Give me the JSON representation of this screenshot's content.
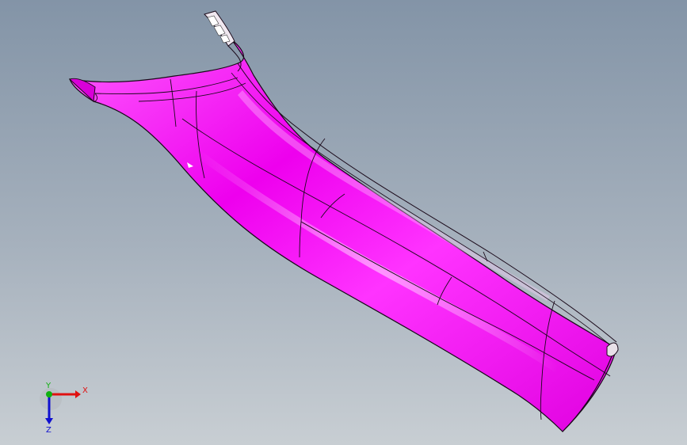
{
  "viewport": {
    "background_top": "#8394a7",
    "background_bottom": "#c8ced3"
  },
  "model": {
    "surface_color": "#ff00ff",
    "edge_color": "#1a0a1a"
  },
  "triad": {
    "x_label": "X",
    "y_label": "Y",
    "z_label": "Z",
    "x_color": "#e01010",
    "y_color": "#10b010",
    "z_color": "#1010d0"
  }
}
